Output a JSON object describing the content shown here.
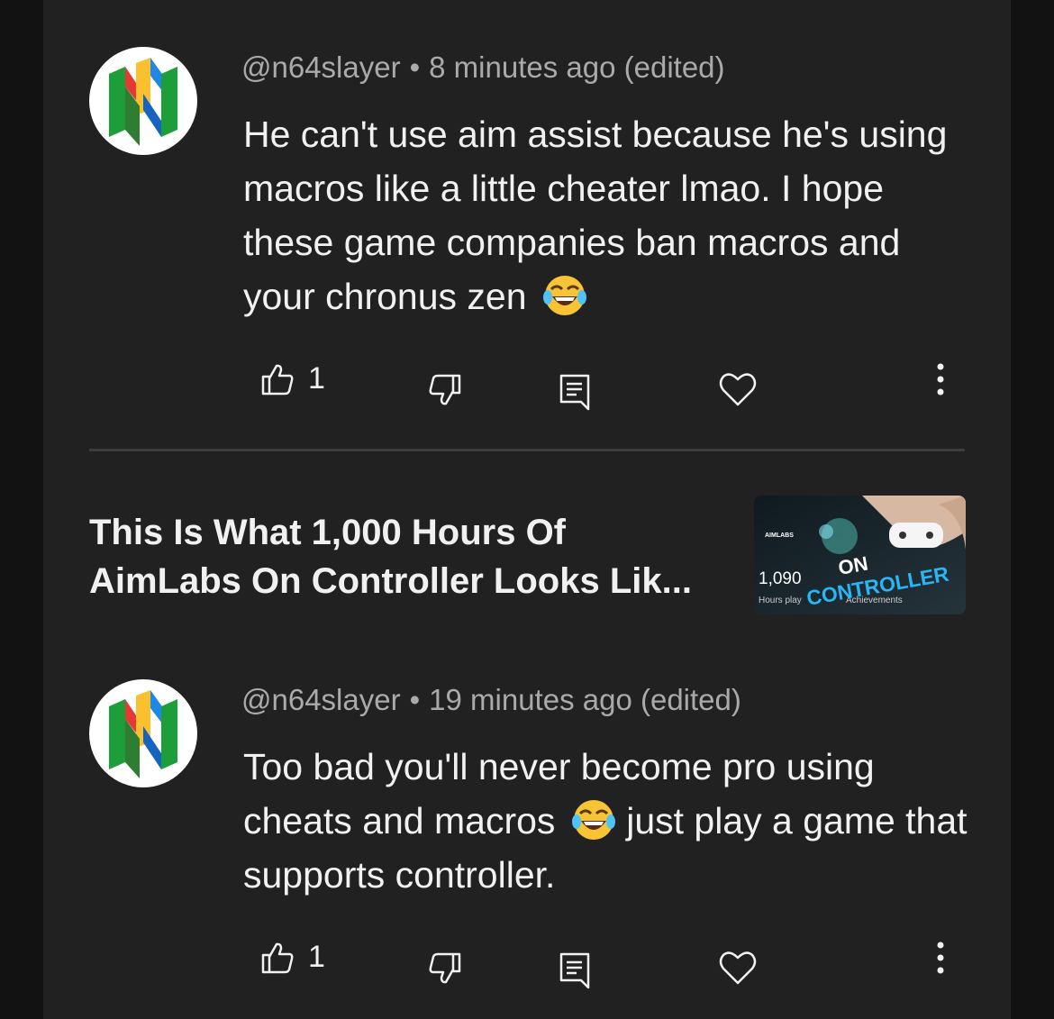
{
  "comments": [
    {
      "handle": "@n64slayer",
      "separator": "•",
      "time": "8 minutes ago (edited)",
      "text_before_emoji": "He can't use aim assist because he's using macros like a little cheater lmao. I hope these game companies ban macros and your chronus zen",
      "text_after_emoji": "",
      "likes": "1"
    },
    {
      "handle": "@n64slayer",
      "separator": "•",
      "time": "19 minutes ago (edited)",
      "text_before_emoji": "Too bad you'll never become pro using cheats and macros",
      "text_after_emoji": " just play a game that supports controller.",
      "likes": "1"
    }
  ],
  "video": {
    "title": "This Is What 1,000 Hours Of AimLabs On Controller Looks Lik...",
    "thumb_brand": "AIMLABS",
    "thumb_hours": "1,090",
    "thumb_hours_label": "Hours play",
    "thumb_achievements": "Achievements",
    "thumb_on": "ON",
    "thumb_controller": "CONTROLLER"
  },
  "colors": {
    "background": "#212121",
    "text": "#f1f1f1",
    "meta": "#aaaaaa",
    "divider": "#3d3d3d",
    "accent_blue": "#29b6f6"
  },
  "icons": [
    "n64-logo-avatar",
    "thumbs-up-icon",
    "thumbs-down-icon",
    "reply-icon",
    "heart-icon",
    "more-vertical-icon",
    "laughing-emoji"
  ]
}
